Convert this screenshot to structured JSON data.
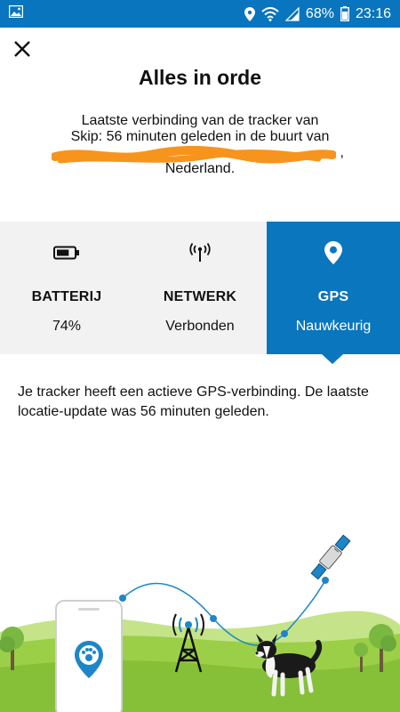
{
  "status_bar": {
    "battery_percent": "68%",
    "time": "23:16",
    "icons": [
      "image-icon",
      "location-icon",
      "wifi-icon",
      "signal-icon",
      "battery-icon"
    ]
  },
  "header": {
    "title": "Alles in orde"
  },
  "connection": {
    "line1": "Laatste verbinding van de tracker van",
    "line2": "Skip: 56 minuten geleden in de buurt van",
    "line3_redacted": "",
    "line4": "Nederland."
  },
  "tiles": [
    {
      "icon": "battery-icon",
      "label": "BATTERIJ",
      "value": "74%",
      "battery_level": 0.74,
      "active": false
    },
    {
      "icon": "antenna-icon",
      "label": "NETWERK",
      "value": "Verbonden",
      "active": false
    },
    {
      "icon": "gps-pin-icon",
      "label": "GPS",
      "value": "Nauwkeurig",
      "active": true
    }
  ],
  "description": "Je tracker heeft een actieve GPS-verbinding. De laatste locatie-update was 56 minuten geleden.",
  "colors": {
    "brand_blue": "#0875be",
    "active_tile": "#0a76bd",
    "tile_bg": "#f2f2f2",
    "grass": "#8cc63f",
    "redaction": "#f7941d"
  }
}
